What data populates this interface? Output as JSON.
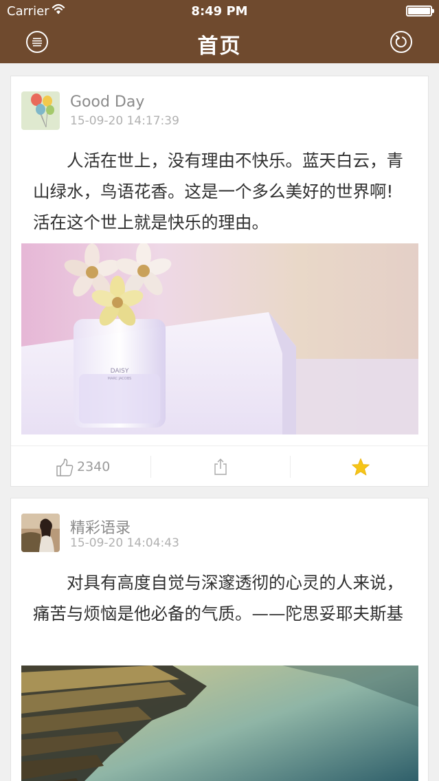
{
  "status_bar": {
    "carrier": "Carrier",
    "time": "8:49 PM"
  },
  "nav": {
    "title": "首页",
    "menu_icon": "menu-icon",
    "refresh_icon": "refresh-icon"
  },
  "colors": {
    "header_bg": "#6f4a2e",
    "star": "#f5c518"
  },
  "posts": [
    {
      "author": "Good Day",
      "time": "15-09-20 14:17:39",
      "text": "人活在世上，没有理由不快乐。蓝天白云，青山绿水，鸟语花香。这是一个多么美好的世界啊!活在这个世上就是快乐的理由。",
      "image_text": "DAISY",
      "image_subtext": "MARC JACOBS",
      "likes": "2340",
      "favorited": true
    },
    {
      "author": "精彩语录",
      "time": "15-09-20 14:04:43",
      "text": "对具有高度自觉与深邃透彻的心灵的人来说，痛苦与烦恼是他必备的气质。——陀思妥耶夫斯基"
    }
  ]
}
